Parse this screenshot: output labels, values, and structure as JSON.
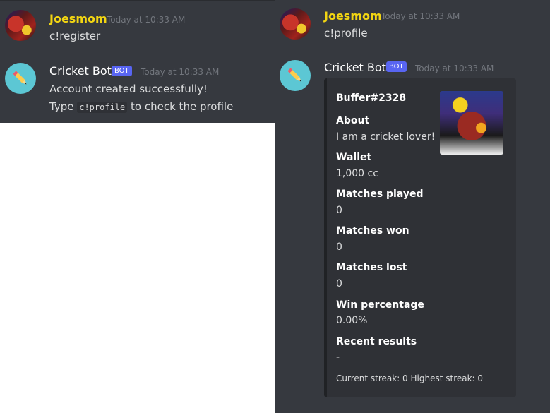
{
  "left": {
    "user_msg": {
      "name": "Joesmom",
      "time": "Today at 10:33 AM",
      "text": "c!register"
    },
    "bot_msg": {
      "name": "Cricket Bot",
      "badge": "BOT",
      "time": "Today at 10:33 AM",
      "line1": "Account created successfully!",
      "line2_pre": "Type",
      "line2_code": "c!profile",
      "line2_post": "to check the profile"
    }
  },
  "right": {
    "user_msg": {
      "name": "Joesmom",
      "time": "Today at 10:33 AM",
      "text": "c!profile"
    },
    "bot_msg": {
      "name": "Cricket Bot",
      "badge": "BOT",
      "time": "Today at 10:33 AM"
    },
    "embed": {
      "title": "Buffer#2328",
      "fields": [
        {
          "name": "About",
          "value": "I am a cricket lover!"
        },
        {
          "name": "Wallet",
          "value": "1,000 cc"
        },
        {
          "name": "Matches played",
          "value": "0"
        },
        {
          "name": "Matches won",
          "value": "0"
        },
        {
          "name": "Matches lost",
          "value": "0"
        },
        {
          "name": "Win percentage",
          "value": "0.00%"
        },
        {
          "name": "Recent results",
          "value": "-"
        }
      ],
      "footer": "Current streak: 0  Highest streak: 0"
    }
  },
  "colors": {
    "background": "#36393f",
    "embed_bg": "#2f3136",
    "username": "#f2d512",
    "badge": "#5865f2"
  },
  "icons": {
    "bot_avatar": "pencil-icon"
  }
}
